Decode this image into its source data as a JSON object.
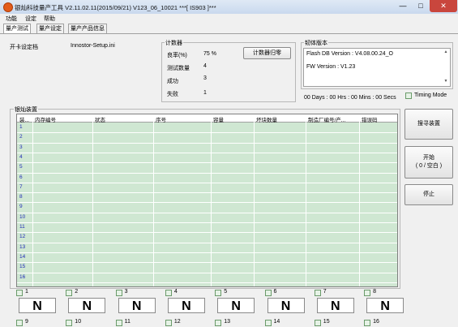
{
  "window": {
    "title": "银灿科技量产工具 V2.11.02.11(2015/09/21)    V123_06_10021             ***[ IS903 ]***",
    "minimize_glyph": "—",
    "maximize_glyph": "□",
    "close_glyph": "✕"
  },
  "menu": {
    "items": [
      "功能",
      "设定",
      "帮助"
    ]
  },
  "tabs": [
    "量产测试",
    "量产设定",
    "量产产品信息"
  ],
  "setup_file": {
    "label": "开卡设定档",
    "value": "Innostor-Setup.ini"
  },
  "counter": {
    "title": "计数器",
    "rows": [
      {
        "label": "良率(%)",
        "value": "75 %"
      },
      {
        "label": "测试数量",
        "value": "4"
      },
      {
        "label": "成功",
        "value": "3"
      },
      {
        "label": "失败",
        "value": "1"
      }
    ],
    "reset_button": "计数器归零"
  },
  "firmware": {
    "title": "韧体版本",
    "flash_db": "Flash DB Version :  V4.08.00.24_O",
    "fw": "FW Version :   V1.23"
  },
  "timer": "00 Days : 00 Hrs : 00 Mins : 00 Secs",
  "timing_mode": "Timing Mode",
  "devices": {
    "title": "银灿装置",
    "columns": [
      "装...",
      "内存编号",
      "状态",
      "序号",
      "容量",
      "坏块数量",
      "制造厂编号/产...",
      "错误码"
    ],
    "rows": [
      "1",
      "2",
      "3",
      "4",
      "5",
      "6",
      "7",
      "8",
      "9",
      "10",
      "11",
      "12",
      "13",
      "14",
      "15",
      "16"
    ]
  },
  "buttons": {
    "search": "搜寻装置",
    "start_line1": "开始",
    "start_line2": "( 0 / 空白 )",
    "stop": "停止"
  },
  "slots": {
    "row1": [
      "1",
      "2",
      "3",
      "4",
      "5",
      "6",
      "7",
      "8"
    ],
    "row2": [
      "9",
      "10",
      "11",
      "12",
      "13",
      "14",
      "15",
      "16"
    ],
    "status": "N"
  }
}
